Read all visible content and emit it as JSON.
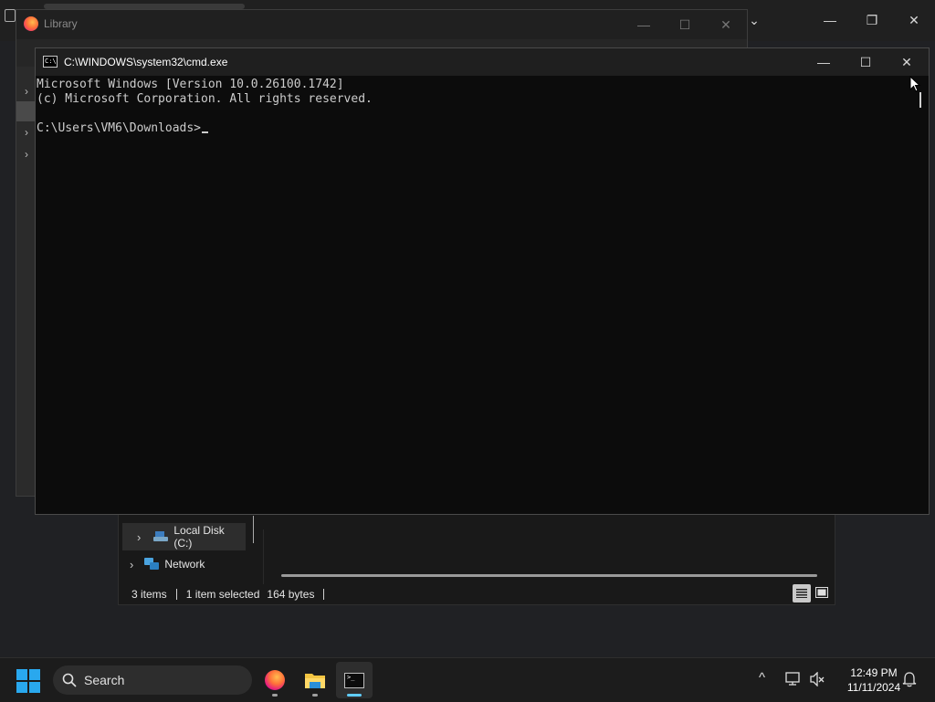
{
  "background_window": {
    "caption_buttons": {
      "minimize": "—",
      "restore": "❐",
      "close": "✕",
      "chevron": "⌄"
    }
  },
  "library": {
    "title": "Library",
    "caption_buttons": {
      "minimize": "—",
      "maximize": "☐",
      "close": "✕"
    }
  },
  "explorer": {
    "nav_items": [
      {
        "label": "Local Disk (C:)",
        "icon": "drive-icon"
      },
      {
        "label": "Network",
        "icon": "network-icon"
      }
    ],
    "status": {
      "items": "3 items",
      "selected": "1 item selected",
      "size": "164 bytes"
    }
  },
  "cmd": {
    "title": "C:\\WINDOWS\\system32\\cmd.exe",
    "icon_text": "C:\\",
    "lines": [
      "Microsoft Windows [Version 10.0.26100.1742]",
      "(c) Microsoft Corporation. All rights reserved.",
      "",
      "C:\\Users\\VM6\\Downloads>"
    ],
    "caption_buttons": {
      "minimize": "—",
      "maximize": "☐",
      "close": "✕"
    }
  },
  "taskbar": {
    "search_placeholder": "Search",
    "apps": [
      "firefox",
      "file-explorer",
      "command-prompt"
    ],
    "clock": {
      "time": "12:49 PM",
      "date": "11/11/2024"
    },
    "tray": {
      "chevron": "^"
    }
  },
  "colors": {
    "accent": "#60cdff",
    "start": "#29a8ee",
    "console_bg": "#0c0c0c",
    "console_text": "#cccccc"
  }
}
